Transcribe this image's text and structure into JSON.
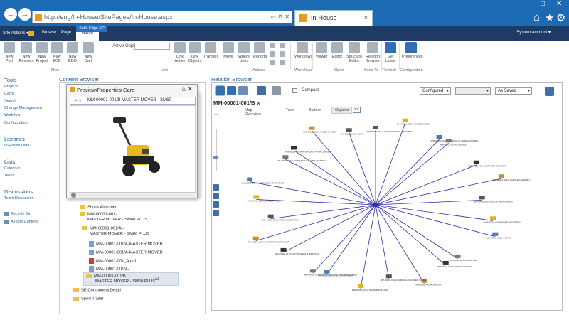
{
  "browser": {
    "url": "http://eng/In-House/SitePages/In-House.aspx",
    "tab_label": "In-House",
    "tab_close": "×",
    "back": "←",
    "forward": "→",
    "win_min": "—",
    "win_max": "□",
    "win_close": "✕",
    "home_icon": "⌂",
    "star_icon": "★",
    "gear_icon": "⚙"
  },
  "sharepoint": {
    "site_actions": "Site Actions ▾",
    "tabs": [
      "Browse",
      "Page",
      "Home"
    ],
    "active_tab": "Home",
    "context_tab": "Solid Edge SP",
    "system_account": "System Account ▾"
  },
  "ribbon": {
    "new_buttons": [
      "New Part",
      "New Revision",
      "New Project",
      "New ECR",
      "New EDO",
      "New Cart"
    ],
    "active_object_label": "Active Object:",
    "link_buttons": [
      "Link Active",
      "Link Objects",
      "Transfer"
    ],
    "action_buttons": [
      "Move",
      "Where Used",
      "Reports"
    ],
    "workflow_buttons": [
      "Workflows"
    ],
    "open_buttons": [
      "Viewer",
      "Editor",
      "Structure Editor"
    ],
    "sendto_buttons": [
      "Relation Browser"
    ],
    "refresh_buttons": [
      "Get Latest"
    ],
    "config_buttons": [
      "Preferences"
    ],
    "groups": [
      "New",
      "Link",
      "Actions",
      "Workflows",
      "Open",
      "Send To",
      "Refresh",
      "Configuration"
    ]
  },
  "leftnav": {
    "tools_header": "Tools",
    "tools": [
      "Projects",
      "Carts",
      "Search",
      "Change Management",
      "Workflow",
      "Configuration"
    ],
    "libraries_header": "Libraries",
    "libraries": [
      "In-House Data"
    ],
    "lists_header": "Lists",
    "lists": [
      "Calendar",
      "Tasks"
    ],
    "discussions_header": "Discussions",
    "discussions": [
      "Team Discussion"
    ],
    "bottom": [
      "Recycle Bin",
      "All Site Content"
    ]
  },
  "content_browser": {
    "title": "Content Browser",
    "tree": [
      {
        "label": "Shock Absorber",
        "kind": "folder"
      },
      {
        "label": "MM-00001-001-",
        "kind": "folder"
      },
      {
        "label": "MASTER MOVER - SM60 PLUS",
        "kind": "text"
      },
      {
        "label": "MM-00001-001/A -",
        "kind": "folder"
      },
      {
        "label": "MASTER MOVER - SM60 PLUS",
        "kind": "text"
      },
      {
        "label": "MM-00001-001/A-MASTER MOVER",
        "kind": "doc"
      },
      {
        "label": "MM-00001-001/A-MASTER MOVER",
        "kind": "doc"
      },
      {
        "label": "MM-00001-001_A.pdf",
        "kind": "pdf"
      },
      {
        "label": "MM-00001-001/A-",
        "kind": "doc"
      },
      {
        "label": "MM-00001-001/B",
        "kind": "folder"
      },
      {
        "label": "MASTER MOVER - SM60 PLUS",
        "kind": "text"
      },
      {
        "label": "SE Component Detail",
        "kind": "folder"
      },
      {
        "label": "Sport Trailer",
        "kind": "folder"
      }
    ]
  },
  "preview": {
    "title": "Preview/Properties Card",
    "item": "MM-00001-001/B MASTER MOVER - SM60",
    "close": "⌂ ✕",
    "arrows": "⇥ ⇣"
  },
  "relation_browser": {
    "title": "Relation Browser",
    "compact_label": "Compact",
    "config_select": "Configured",
    "blank_select": "",
    "saved_select": "As Saved",
    "item_title": "MM-00001-001/B",
    "item_close": "x",
    "view_tabs": [
      "Map Overview",
      "Tree",
      "Balloon",
      "Organic"
    ],
    "active_view_tab": "Organic",
    "collapse_label": "<<",
    "zoom_in": "+",
    "zoom_out": "−"
  },
  "graph_nodes": [
    {
      "label": "MM-00001-001/A CASTOR WHEEL ASSEMBLY"
    },
    {
      "label": "MM-00001-001/A HOSE BRACKET"
    },
    {
      "label": "MM-00001-001/A HYDRAULIC HOSE ASSEMBLY"
    },
    {
      "label": "MM-00001-001/A CHASSIS"
    },
    {
      "label": "MM-00001-001/A SUPPORT BRACKET"
    },
    {
      "label": "MM-00001-001/A HANDLE ASSEMBLY"
    },
    {
      "label": "MM-00001-001/A HEIGHT ADJUSTMENT"
    },
    {
      "label": "MM-00001-001/A WHEEL ASSEMBLY"
    },
    {
      "label": "MM-00001-001/A MOTOR"
    },
    {
      "label": "MM-00001-001/A WEAR PAD"
    },
    {
      "label": "MM-00001-001/A HYDRAULIC TANK"
    },
    {
      "label": "MM-00001-001/A SPACER"
    },
    {
      "label": "MM-00001-001/A HYDRAULIC LOWER COVER"
    },
    {
      "label": "MM-00001-001/A RETAINING PLATE"
    },
    {
      "label": "MM-00001-001/A SE FLAT WASHER"
    },
    {
      "label": "MM-00001-001/A HYDRAULIC ACTUATOR ASSEMBLY"
    },
    {
      "label": "MM-00001-001/A FRONT WEIGHT BRACKET"
    },
    {
      "label": "MM-00001-001/A SUPPORTING BRACKET"
    },
    {
      "label": "MM-00001-001/A HYDRAULIC PUMP"
    },
    {
      "label": "MM-00001-001/A BATTERY PACK"
    },
    {
      "label": "MM-00001-001/A MULTI WEIGHT BRACKET"
    },
    {
      "label": "MM-00001-001/A ADJUSTABLE CLAMP ASSEMBLY"
    },
    {
      "label": "MM-00001-001/A HYDRAULIC PUMP CHASSIS"
    },
    {
      "label": "MM-00001-001/A TILLER HANDLE"
    },
    {
      "label": "MM-00001-001/A BOLT"
    }
  ]
}
